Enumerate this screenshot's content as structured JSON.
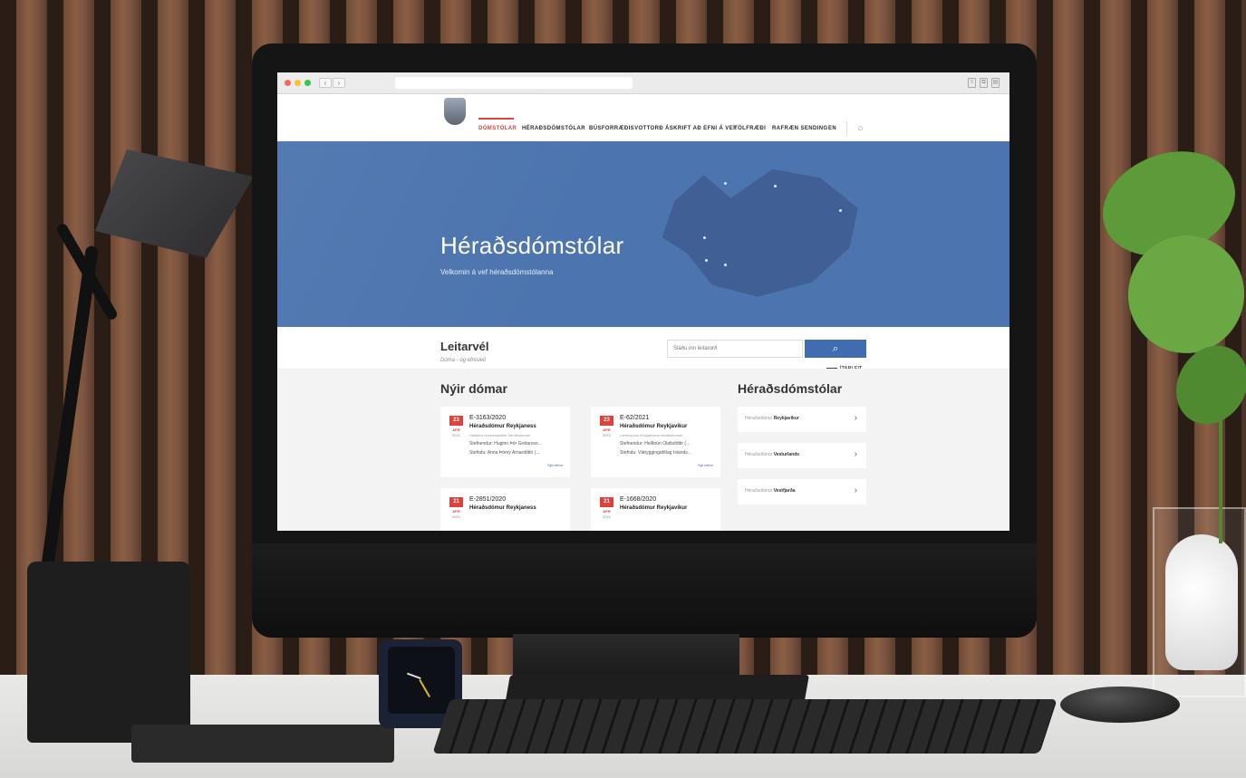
{
  "browser": {
    "back_glyph": "‹",
    "forward_glyph": "›",
    "traffic_colors": [
      "#ff5f57",
      "#febc2e",
      "#28c840"
    ]
  },
  "nav": {
    "items": [
      {
        "label": "DÓMSTÓLAR",
        "active": true
      },
      {
        "label": "HÉRAÐSDÓMSTÓLAR",
        "active": false
      },
      {
        "label": "BÚSFORRÆÐISVOTTORÐ",
        "active": false
      },
      {
        "label": "ÁSKRIFT AÐ EFNI Á VEF",
        "active": false
      },
      {
        "label": "TÖLFRÆÐI",
        "active": false
      },
      {
        "label": "RAFRÆN SENDING",
        "active": false
      },
      {
        "label": "EN",
        "active": false
      }
    ],
    "search_icon": "search-icon"
  },
  "hero": {
    "title": "Héraðsdómstólar",
    "subtitle": "Velkomin á vef héraðsdómstólanna"
  },
  "search": {
    "title": "Leitarvél",
    "subtitle": "Dóma - og efnisleit",
    "placeholder": "Sláðu inn leitarorð",
    "button_glyph": "⌕",
    "advanced_label": "ÍTARLEIT"
  },
  "judgments": {
    "title": "Nýir dómar",
    "cards": [
      {
        "day": "23",
        "month": "APR",
        "year": "2021",
        "case_no": "E-3163/2020",
        "court": "Héraðsdómur Reykjaness",
        "judge": "Halldóra Þorsteinsdóttir héraðsdómari",
        "plaintiff": "Stefnendur: Huginn Þór Grétarsso...",
        "defendant": "Stefndu: Anna Þórey Arnardóttir (...",
        "link": "Sjá reifun"
      },
      {
        "day": "23",
        "month": "APR",
        "year": "2021",
        "case_no": "E-62/2021",
        "court": "Héraðsdómur Reykjavíkur",
        "judge": "Lárentsínus Kristjánsson héraðsdómari",
        "plaintiff": "Stefnendur: Hellbrún Ólafsdóttir (...",
        "defendant": "Stefndu: Vátryggingafélag Íslands...",
        "link": "Sjá reifun"
      },
      {
        "day": "21",
        "month": "APR",
        "year": "2021",
        "case_no": "E-2851/2020",
        "court": "Héraðsdómur Reykjaness",
        "judge": "",
        "plaintiff": "",
        "defendant": "",
        "link": ""
      },
      {
        "day": "21",
        "month": "APR",
        "year": "2021",
        "case_no": "E-1668/2020",
        "court": "Héraðsdómur Reykjavíkur",
        "judge": "",
        "plaintiff": "",
        "defendant": "",
        "link": ""
      }
    ]
  },
  "courts": {
    "title": "Héraðsdómstólar",
    "items": [
      {
        "prefix": "Héraðsdómur ",
        "name": "Reykjavíkur"
      },
      {
        "prefix": "Héraðsdómur ",
        "name": "Vesturlands"
      },
      {
        "prefix": "Héraðsdómur ",
        "name": "Vestfjarða"
      }
    ],
    "arrow_glyph": "›"
  },
  "colors": {
    "accent_red": "#e0403a",
    "hero_blue": "#4c74ae",
    "button_blue": "#3f6db0"
  }
}
